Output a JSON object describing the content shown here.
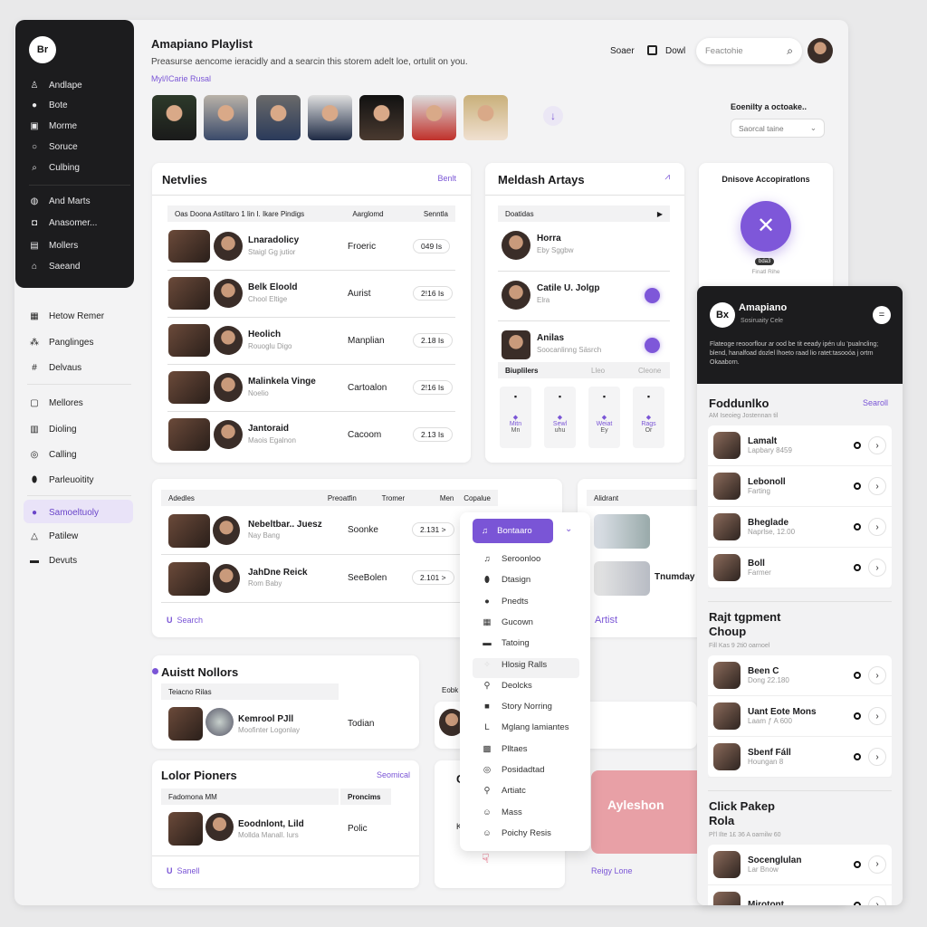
{
  "app": {
    "logo": "Br",
    "title": "Amapiano Playlist",
    "description": "Preasurse aencome ieracidly and a searcin this storem adelt loe, ortulit on you.",
    "link": "Myl/ICarie Rusal"
  },
  "colors": {
    "accent": "#7a55d6",
    "dark": "#1c1c1e",
    "pink": "#e8a0a6"
  },
  "sidebar": {
    "dark_items": [
      {
        "icon": "person-icon",
        "label": "Andlape"
      },
      {
        "icon": "user-icon",
        "label": "Bote"
      },
      {
        "icon": "image-icon",
        "label": "Morme"
      },
      {
        "icon": "circle-icon",
        "label": "Soruce"
      },
      {
        "icon": "search-icon",
        "label": "Culbing"
      },
      {
        "icon": "headphones-icon",
        "label": "And Marts"
      },
      {
        "icon": "radio-icon",
        "label": "Anasomer..."
      },
      {
        "icon": "folder-icon",
        "label": "Mollers"
      },
      {
        "icon": "home-icon",
        "label": "Saeand"
      }
    ],
    "light_items": [
      {
        "icon": "briefcase-icon",
        "label": "Hetow Remer"
      },
      {
        "icon": "group-icon",
        "label": "Panglinges"
      },
      {
        "icon": "hash-icon",
        "label": "Delvaus"
      },
      {
        "icon": "library-icon",
        "label": "Mellores"
      },
      {
        "icon": "chart-icon",
        "label": "Dioling"
      },
      {
        "icon": "globe-icon",
        "label": "Calling"
      },
      {
        "icon": "pin-icon",
        "label": "Parleuoitity"
      },
      {
        "icon": "user-icon",
        "label": "Samoeltuoly",
        "active": true
      },
      {
        "icon": "triangle-icon",
        "label": "Patilew"
      },
      {
        "icon": "card-icon",
        "label": "Devuts"
      }
    ]
  },
  "topbar": {
    "link1": "Soaer",
    "link2": "Dowl",
    "search_placeholder": "Feactohie",
    "filter_label": "Eoenilty a octoake..",
    "filter_value": "Saorcal taine"
  },
  "netvlies": {
    "title": "Netvlies",
    "action": "Benlt",
    "headers": [
      "Oas Doona Astiltaro 1 lin I. Ikare Pindigs",
      "Aarglomd",
      "Senntla"
    ],
    "rows": [
      {
        "name": "Lnaradolicy",
        "sub": "Staigl Gg jutior",
        "genre": "Froeric",
        "time": "049 Is"
      },
      {
        "name": "Belk Eloold",
        "sub": "Chool Eltige",
        "genre": "Aurist",
        "time": "2!16 Is"
      },
      {
        "name": "Heolich",
        "sub": "Rouoglu Digo",
        "genre": "Manplian",
        "time": "2.18 Is"
      },
      {
        "name": "Malinkela Vinge",
        "sub": "Noelio",
        "genre": "Cartoalon",
        "time": "2!16 Is"
      },
      {
        "name": "Jantoraid",
        "sub": "Maois Egalnon",
        "genre": "Cacoom",
        "time": "2.13 Is"
      }
    ]
  },
  "meldash": {
    "title": "Meldash Artays",
    "header": "Doatidas",
    "rows": [
      {
        "name": "Horra",
        "sub": "Eby Sggbw"
      },
      {
        "name": "Catile U. Jolgp",
        "sub": "Elra"
      },
      {
        "name": "Anilas",
        "sub": "Soocanlinng Säsrch"
      }
    ],
    "tabs": [
      "Biuplilers",
      "Lleo",
      "Cleone"
    ],
    "tiles": [
      {
        "a": "Mitn",
        "b": "Mn"
      },
      {
        "a": "Sewl",
        "b": "uhu"
      },
      {
        "a": "Weiat",
        "b": "Ey"
      },
      {
        "a": "Rags",
        "b": "Or"
      }
    ]
  },
  "dnisove": {
    "title": "Dnisove Accopiratlons",
    "badge": "bda3",
    "caption": "Finatl Rihe"
  },
  "panel": {
    "title": "Amapiano",
    "logo": "Bx",
    "subtitle": "Sosiruaity Cele",
    "text": "Flateoge reooorflour ar ood be tit eeady ipén ulu 'pualncling; blend, hanalfoad dozlel lhoeto raad lio ratet:tasooóa j ortrn Okaaborn.",
    "sections": [
      {
        "title": "Foddunlko",
        "action": "Searoll",
        "sub": "AM Iseoieg Jostennan til",
        "rows": [
          {
            "name": "Lamalt",
            "sub": "Lapbary 8459"
          },
          {
            "name": "Lebonoll",
            "sub": "Farting"
          },
          {
            "name": "Bheglade",
            "sub": "Naprlse, 12.00"
          },
          {
            "name": "Boll",
            "sub": "Farmer"
          }
        ]
      },
      {
        "title": "Rajt tgpment Choup",
        "sub": "Fill Kas 9 2ti0 oarnoel",
        "rows": [
          {
            "name": "Been C",
            "sub": "Dong 22.180"
          },
          {
            "name": "Uant Eote Mons",
            "sub": "Laam ƒ A 600"
          },
          {
            "name": "Sbenf Fáll",
            "sub": "Houngan 8"
          }
        ]
      },
      {
        "title": "Click Pakep Rola",
        "sub": "Pl'l Ilte 1£ 36 A oarnilw 60",
        "rows": [
          {
            "name": "Socenglulan",
            "sub": "Lar Bnow"
          },
          {
            "name": "Mirotont",
            "sub": ""
          }
        ]
      }
    ]
  },
  "adedles": {
    "headers": [
      "Adedles",
      "Preoatfin",
      "Tromer",
      "Men",
      "Copalue"
    ],
    "rows": [
      {
        "name": "Nebeltbar.. Juesz",
        "sub": "Nay Bang",
        "genre": "Soonke",
        "time": "2.131 >"
      },
      {
        "name": "JahDne Reick",
        "sub": "Rom Baby",
        "genre": "SeeBolen",
        "time": "2.101 >"
      }
    ],
    "action": "Search"
  },
  "alidrant": {
    "header": "Alidrant",
    "row": "Tnumday",
    "action": "Artist"
  },
  "dropdown": {
    "selected": "Bontaaro",
    "items": [
      {
        "icon": "music-icon",
        "label": "Seroonloo"
      },
      {
        "icon": "pin-icon",
        "label": "Dtasign"
      },
      {
        "icon": "info-icon",
        "label": "Pnedts"
      },
      {
        "icon": "calendar-icon",
        "label": "Gucown"
      },
      {
        "icon": "list-icon",
        "label": "Tatoing"
      },
      {
        "icon": "star-icon",
        "label": "Hlosig Ralls"
      },
      {
        "icon": "microphone-icon",
        "label": "Deolcks"
      },
      {
        "icon": "square-icon",
        "label": "Story Norring"
      },
      {
        "icon": "corner-icon",
        "label": "Mglang lamiantes"
      },
      {
        "icon": "chat-icon",
        "label": "Plltaes"
      },
      {
        "icon": "globe-icon",
        "label": "Posidadtad"
      },
      {
        "icon": "microphone-icon",
        "label": "Artiatc"
      },
      {
        "icon": "smile-icon",
        "label": "Mass"
      },
      {
        "icon": "smile-icon",
        "label": "Poichy Resis"
      }
    ]
  },
  "auistt": {
    "title": "Auistt Nollors",
    "header": "Teiacno Rilas",
    "row": {
      "name": "Kemrool PJll",
      "sub": "Moofinter Logonlay",
      "genre": "Todian"
    },
    "side_header": "Eobk"
  },
  "lolor": {
    "title": "Lolor Pioners",
    "action": "Seomical",
    "headers": [
      "Fadomona MM",
      "Proncims"
    ],
    "row": {
      "name": "Eoodnlont, Lild",
      "sub": "Mollda Manall. lurs",
      "genre": "Polic"
    },
    "footer": "Sanell"
  },
  "promo": {
    "title": "Ayleshon",
    "link": "Reigy Lone",
    "letter1": "C",
    "letter2": "K"
  }
}
